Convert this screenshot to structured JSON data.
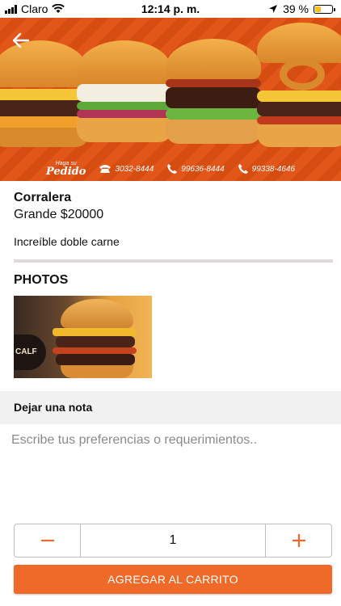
{
  "status_bar": {
    "carrier": "Claro",
    "time": "12:14 p. m.",
    "battery": "39 %",
    "battery_level": 0.39
  },
  "banner": {
    "brand": "Pedido",
    "brand_prefix": "Haga su",
    "phones": [
      "3032-8444",
      "99636-8444",
      "99338-4646"
    ]
  },
  "product": {
    "name": "Corralera",
    "size_price": "Grande $20000",
    "description": "Increíble doble carne"
  },
  "photos": {
    "heading": "PHOTOS",
    "logo_text": "CALF"
  },
  "note": {
    "heading": "Dejar una nota",
    "placeholder": "Escribe tus preferencias o requerimientos.."
  },
  "quantity": {
    "value": "1"
  },
  "cart_button": {
    "label": "AGREGAR AL CARRITO"
  },
  "colors": {
    "accent": "#ef6a28",
    "banner": "#e2561a"
  }
}
